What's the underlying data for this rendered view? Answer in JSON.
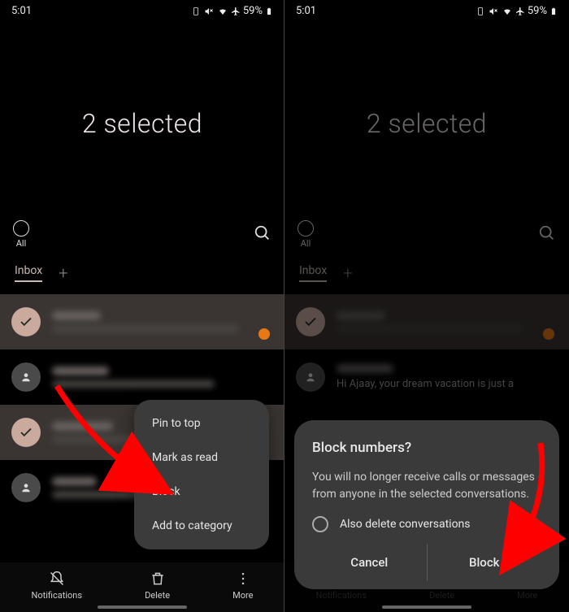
{
  "status": {
    "time": "5:01",
    "battery_pct": "59%"
  },
  "left": {
    "title": "2 selected",
    "filter_all": "All",
    "tab_inbox": "Inbox",
    "menu": {
      "pin": "Pin to top",
      "mark_read": "Mark as read",
      "block": "Block",
      "add_cat": "Add to category"
    },
    "nav": {
      "notifications": "Notifications",
      "delete": "Delete",
      "more": "More"
    }
  },
  "right": {
    "title": "2 selected",
    "filter_all": "All",
    "tab_inbox": "Inbox",
    "row2_preview_prefix": "Hi Ajaay, your dream vacation is just a",
    "dialog": {
      "title": "Block numbers?",
      "body": "You will no longer receive calls or messages from anyone in the selected conversations.",
      "checkbox": "Also delete conversations",
      "cancel": "Cancel",
      "block": "Block"
    },
    "nav": {
      "notifications": "Notifications",
      "delete": "Delete",
      "more": "More"
    }
  }
}
